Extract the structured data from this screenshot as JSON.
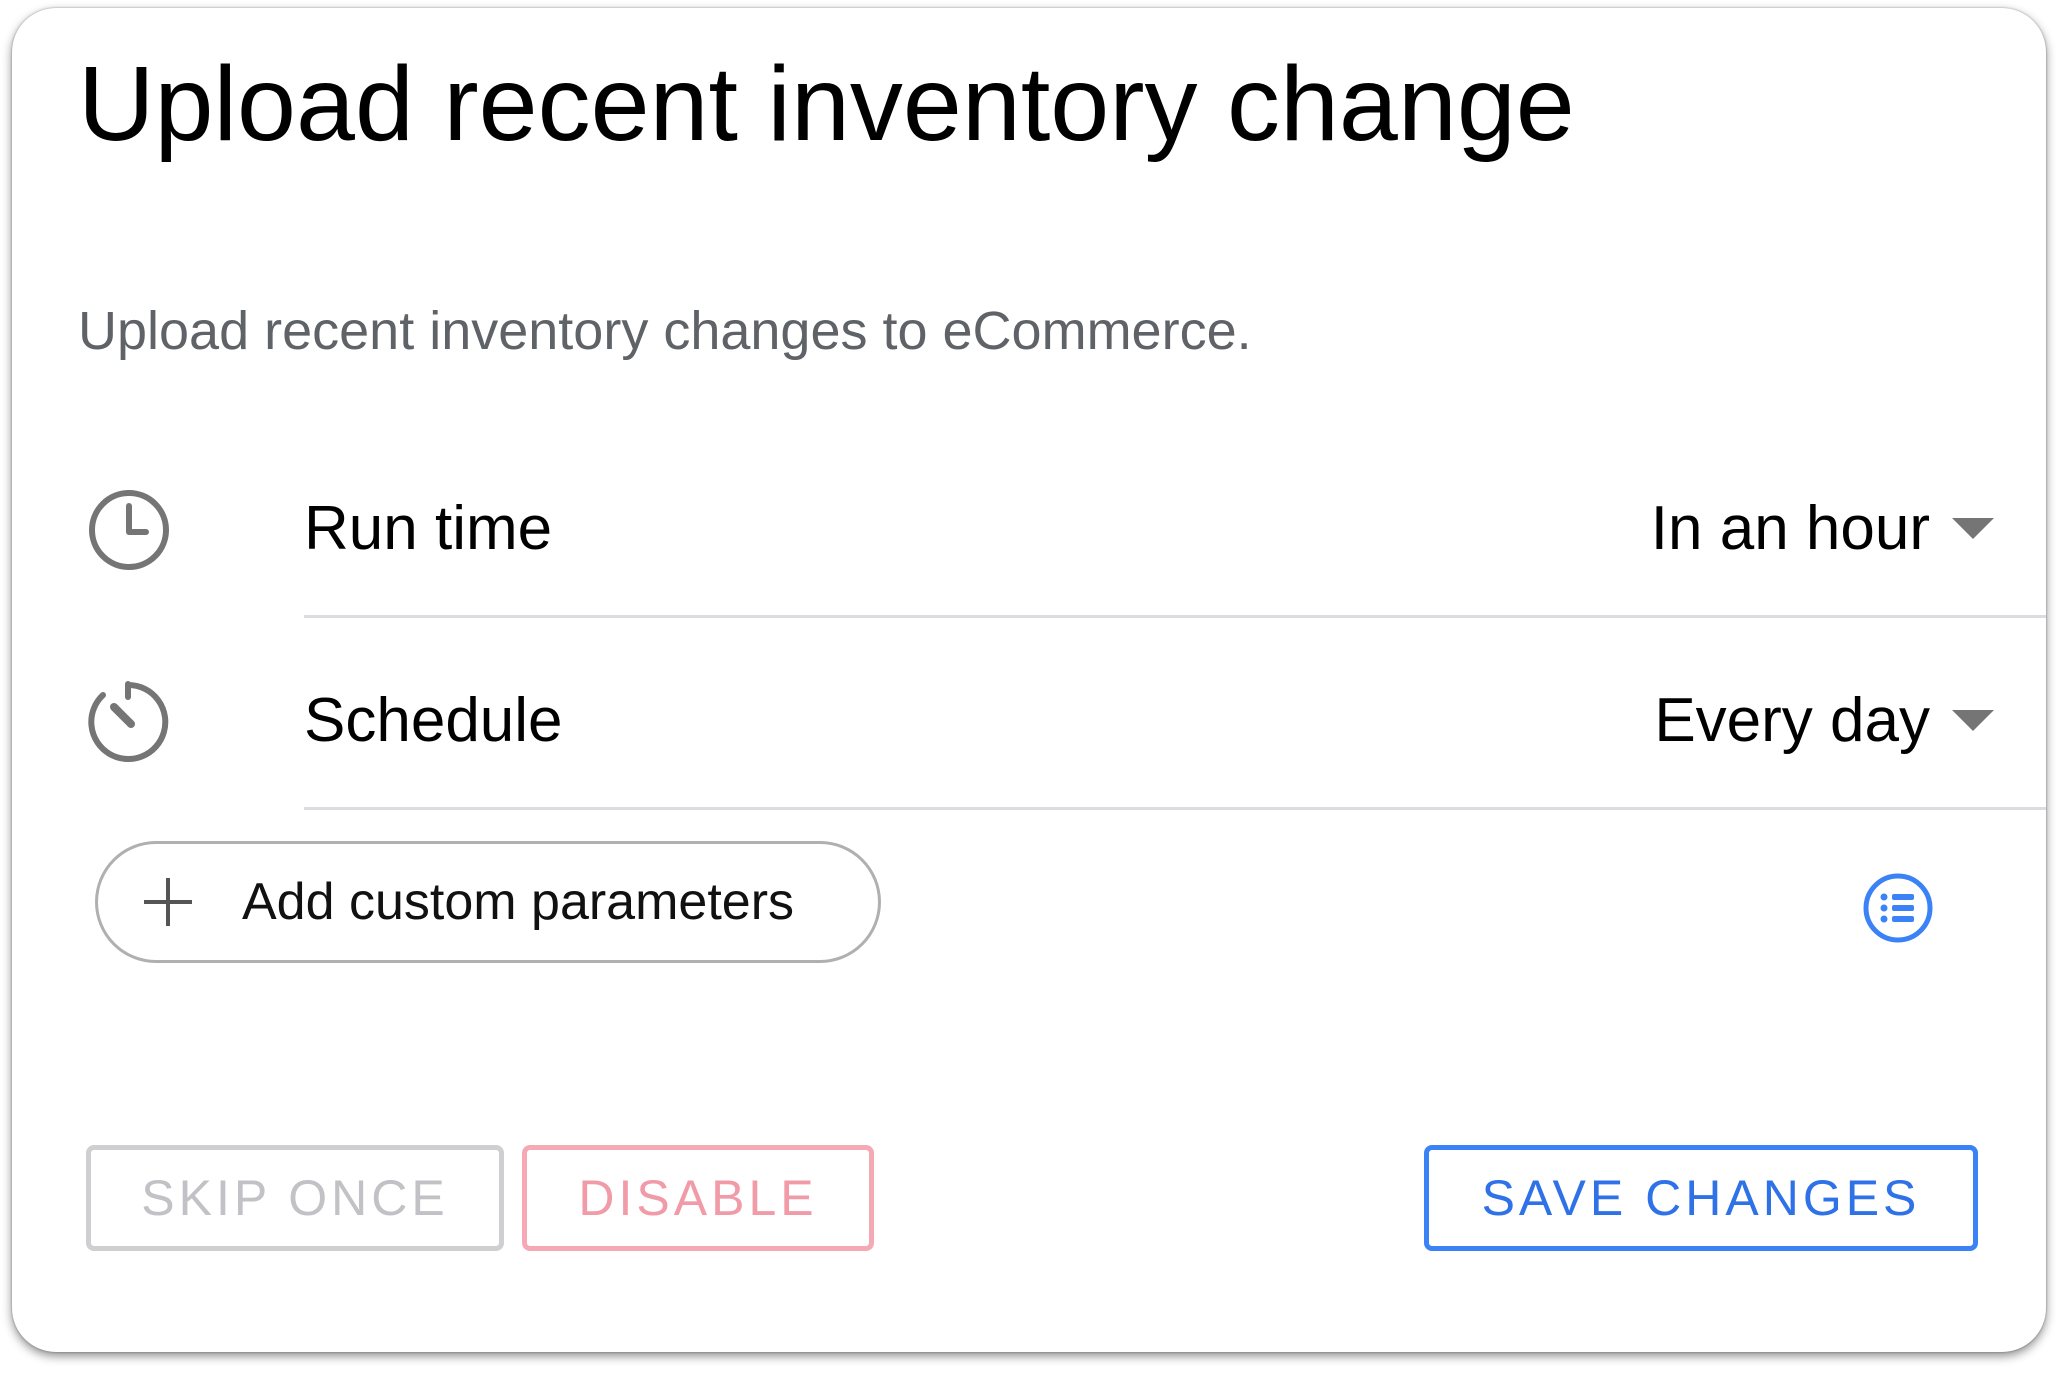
{
  "dialog": {
    "title": "Upload recent inventory change",
    "description": "Upload recent inventory changes to eCommerce."
  },
  "rows": [
    {
      "icon": "clock-icon",
      "label": "Run time",
      "value": "In an hour"
    },
    {
      "icon": "timer-icon",
      "label": "Schedule",
      "value": "Every day"
    }
  ],
  "custom_params": {
    "icon": "plus-icon",
    "label": "Add custom parameters",
    "list_icon": "list-icon"
  },
  "actions": {
    "skip_once": "SKIP ONCE",
    "disable": "DISABLE",
    "save_changes": "SAVE CHANGES"
  },
  "colors": {
    "accent_blue": "#3b82f6",
    "disable_pink": "#f19aa8",
    "muted_gray": "#c2c2c6",
    "description_gray": "#5f6368",
    "icon_gray": "#757575"
  }
}
